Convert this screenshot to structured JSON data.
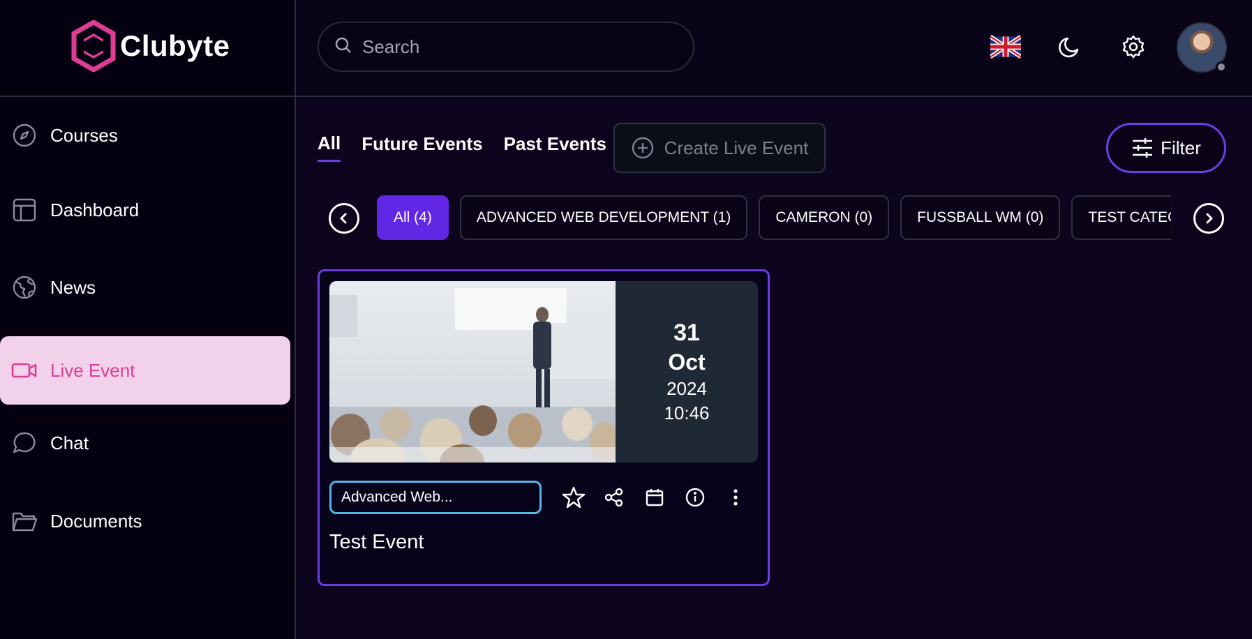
{
  "brand": {
    "name": "Clubyte",
    "color": "#dd3d95"
  },
  "search": {
    "placeholder": "Search"
  },
  "topbar": {
    "icons": [
      "uk-flag-icon",
      "moon-icon",
      "gear-icon",
      "avatar"
    ]
  },
  "sidebar": {
    "items": [
      {
        "label": "Courses",
        "icon": "compass-icon",
        "active": false
      },
      {
        "label": "Dashboard",
        "icon": "layout-icon",
        "active": false
      },
      {
        "label": "News",
        "icon": "globe-icon",
        "active": false
      },
      {
        "label": "Live Event",
        "icon": "video-icon",
        "active": true
      },
      {
        "label": "Chat",
        "icon": "chat-bubble-icon",
        "active": false
      },
      {
        "label": "Documents",
        "icon": "folder-icon",
        "active": false
      }
    ]
  },
  "tabs": [
    {
      "label": "All",
      "active": true
    },
    {
      "label": "Future Events",
      "active": false
    },
    {
      "label": "Past Events",
      "active": false
    }
  ],
  "create_button": {
    "label": "Create Live Event",
    "icon": "plus-circle-icon"
  },
  "filter_button": {
    "label": "Filter",
    "icon": "sliders-icon"
  },
  "categories": [
    {
      "label": "All (4)",
      "active": true
    },
    {
      "label": "ADVANCED WEB DEVELOPMENT (1)",
      "active": false
    },
    {
      "label": "CAMERON (0)",
      "active": false
    },
    {
      "label": "FUSSBALL WM (0)",
      "active": false
    },
    {
      "label": "TEST CATEGORY",
      "active": false
    }
  ],
  "event_card": {
    "day": "31",
    "month": "Oct",
    "year": "2024",
    "time": "10:46",
    "category": "Advanced Web...",
    "title": "Test Event",
    "actions": [
      "star-icon",
      "share-icon",
      "calendar-icon",
      "info-icon",
      "more-vertical-icon"
    ]
  },
  "colors": {
    "accent": "#6d3ee8",
    "chip_active": "#6226e5",
    "tag_border": "#53b8e6",
    "active_nav_bg": "#f2d2ea"
  }
}
